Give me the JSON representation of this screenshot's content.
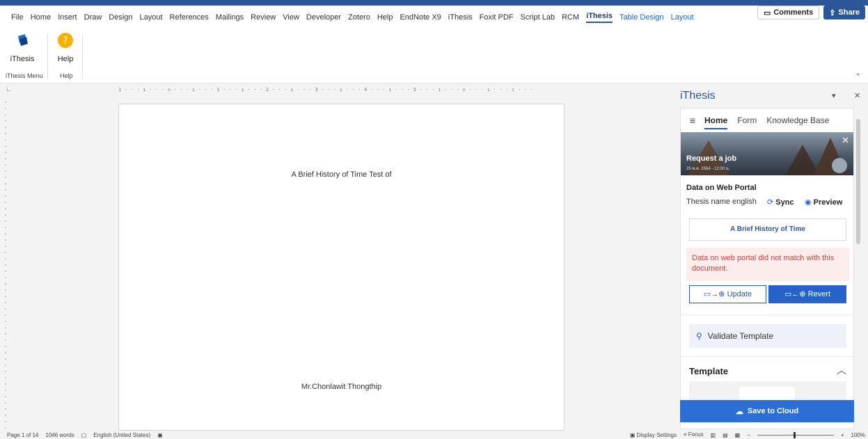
{
  "menubar": {
    "items": [
      "File",
      "Home",
      "Insert",
      "Draw",
      "Design",
      "Layout",
      "References",
      "Mailings",
      "Review",
      "View",
      "Developer",
      "Zotero",
      "Help",
      "EndNote X9",
      "iThesis",
      "Foxit PDF",
      "Script Lab",
      "RCM",
      "iThesis",
      "Table Design",
      "Layout"
    ],
    "comments": "Comments",
    "share": "Share"
  },
  "ribbon": {
    "ithesis_btn": "iThesis",
    "help_btn": "Help",
    "group1": "iThesis Menu",
    "group2": "Help"
  },
  "ruler": {
    "marks": "1 · · · ı · · · ⌂ · · · ı · · · 1 · · · ı · · · 2 · · · ı · · · 3 · · · ı · · · 4 · · · ı · · · 5 · · · ı · · · ⌂ · · · ı · · · ı · · ·"
  },
  "doc": {
    "title": "A Brief History of Time Test of",
    "author": "Mr.Chonlawit Thongthip"
  },
  "pane": {
    "title": "iThesis",
    "tabs": [
      "Home",
      "Form",
      "Knowledge Base"
    ],
    "banner_title": "Request a job",
    "banner_sub": "25 พ.ค. 2564 - 12:00 น.",
    "section_title": "Data on Web Portal",
    "thesis_label": "Thesis name english",
    "sync": "Sync",
    "preview": "Preview",
    "thesis_name": "A Brief History of Time",
    "alert": "Data on web portal did not match with this document.",
    "update": "Update",
    "revert": "Revert",
    "validate": "Validate Template",
    "template": "Template",
    "save_cloud": "Save to Cloud"
  },
  "status": {
    "page": "Page 1 of 14",
    "words": "1046 words",
    "lang": "English (United States)",
    "display": "Display Settings",
    "focus": "Focus",
    "zoom": "100%"
  }
}
